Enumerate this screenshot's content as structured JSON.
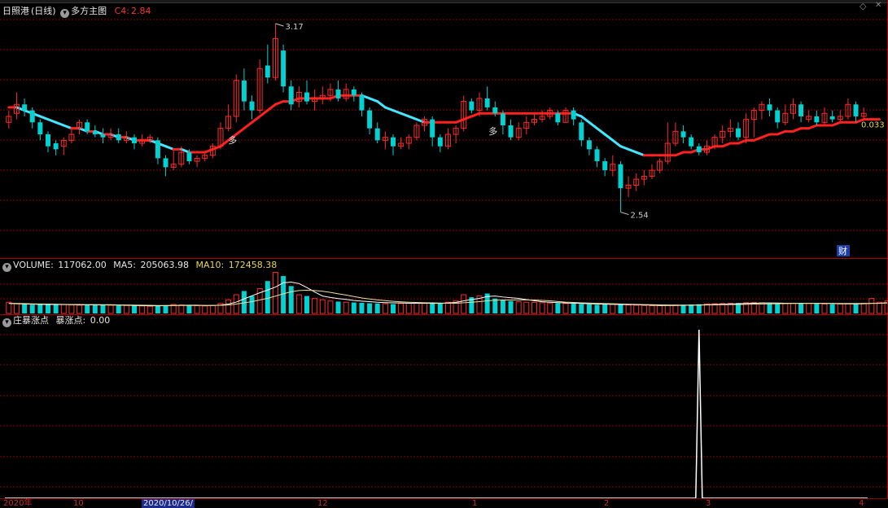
{
  "header": {
    "stock_name": "日照港",
    "period": "(日线)",
    "indicator_name": "多方主图",
    "c4_label": "C4:",
    "c4_value": "2.84"
  },
  "volume_header": {
    "label": "VOLUME:",
    "value": "117062.00",
    "ma5_label": "MA5:",
    "ma5_value": "205063.98",
    "ma10_label": "MA10:",
    "ma10_value": "172458.38"
  },
  "indicator_header": {
    "name": "庄暴涨点",
    "label": "暴涨点:",
    "value": "0.00"
  },
  "annotations": {
    "high": "3.17",
    "low": "2.54",
    "right_value": "0.033",
    "signal_a": "多",
    "signal_b": "多",
    "finance_badge": "财"
  },
  "date_axis": {
    "left_year": "2020年",
    "selected_date": "2020/10/26/",
    "months": [
      "10",
      "12",
      "1",
      "2",
      "3",
      "4"
    ]
  },
  "colors": {
    "up": "#ff2a2a",
    "down": "#00d2d2",
    "ma_up": "#ff2020",
    "ma_down": "#44e6ff",
    "grid": "#8b0000",
    "ma10": "#e8e0a0",
    "spike": "#ffffff"
  },
  "chart_data": {
    "type": "candlestick",
    "title": "",
    "price_range": [
      2.4,
      3.2
    ],
    "highest": 3.17,
    "lowest": 2.54,
    "candles": [
      {
        "o": 2.84,
        "c": 2.86,
        "h": 2.88,
        "l": 2.82
      },
      {
        "o": 2.87,
        "c": 2.9,
        "h": 2.94,
        "l": 2.85
      },
      {
        "o": 2.9,
        "c": 2.88,
        "h": 2.92,
        "l": 2.86
      },
      {
        "o": 2.88,
        "c": 2.84,
        "h": 2.89,
        "l": 2.82
      },
      {
        "o": 2.84,
        "c": 2.8,
        "h": 2.85,
        "l": 2.78
      },
      {
        "o": 2.8,
        "c": 2.76,
        "h": 2.81,
        "l": 2.74
      },
      {
        "o": 2.77,
        "c": 2.75,
        "h": 2.78,
        "l": 2.73
      },
      {
        "o": 2.76,
        "c": 2.78,
        "h": 2.79,
        "l": 2.73
      },
      {
        "o": 2.78,
        "c": 2.8,
        "h": 2.82,
        "l": 2.77
      },
      {
        "o": 2.82,
        "c": 2.84,
        "h": 2.85,
        "l": 2.8
      },
      {
        "o": 2.84,
        "c": 2.81,
        "h": 2.85,
        "l": 2.8
      },
      {
        "o": 2.81,
        "c": 2.8,
        "h": 2.83,
        "l": 2.79
      },
      {
        "o": 2.8,
        "c": 2.79,
        "h": 2.82,
        "l": 2.77
      },
      {
        "o": 2.79,
        "c": 2.8,
        "h": 2.82,
        "l": 2.78
      },
      {
        "o": 2.8,
        "c": 2.78,
        "h": 2.82,
        "l": 2.77
      },
      {
        "o": 2.78,
        "c": 2.79,
        "h": 2.81,
        "l": 2.77
      },
      {
        "o": 2.79,
        "c": 2.77,
        "h": 2.8,
        "l": 2.75
      },
      {
        "o": 2.77,
        "c": 2.78,
        "h": 2.8,
        "l": 2.76
      },
      {
        "o": 2.78,
        "c": 2.79,
        "h": 2.8,
        "l": 2.77
      },
      {
        "o": 2.78,
        "c": 2.72,
        "h": 2.79,
        "l": 2.7
      },
      {
        "o": 2.72,
        "c": 2.69,
        "h": 2.73,
        "l": 2.66
      },
      {
        "o": 2.69,
        "c": 2.7,
        "h": 2.75,
        "l": 2.68
      },
      {
        "o": 2.7,
        "c": 2.74,
        "h": 2.76,
        "l": 2.69
      },
      {
        "o": 2.74,
        "c": 2.71,
        "h": 2.75,
        "l": 2.7
      },
      {
        "o": 2.71,
        "c": 2.72,
        "h": 2.73,
        "l": 2.69
      },
      {
        "o": 2.72,
        "c": 2.73,
        "h": 2.74,
        "l": 2.71
      },
      {
        "o": 2.73,
        "c": 2.76,
        "h": 2.77,
        "l": 2.72
      },
      {
        "o": 2.76,
        "c": 2.82,
        "h": 2.84,
        "l": 2.75
      },
      {
        "o": 2.82,
        "c": 2.86,
        "h": 2.9,
        "l": 2.81
      },
      {
        "o": 2.86,
        "c": 2.98,
        "h": 3.0,
        "l": 2.84
      },
      {
        "o": 2.98,
        "c": 2.91,
        "h": 3.02,
        "l": 2.88
      },
      {
        "o": 2.91,
        "c": 2.88,
        "h": 2.93,
        "l": 2.85
      },
      {
        "o": 2.88,
        "c": 3.02,
        "h": 3.05,
        "l": 2.87
      },
      {
        "o": 3.03,
        "c": 2.99,
        "h": 3.1,
        "l": 2.97
      },
      {
        "o": 2.99,
        "c": 3.12,
        "h": 3.17,
        "l": 2.98
      },
      {
        "o": 3.08,
        "c": 2.96,
        "h": 3.1,
        "l": 2.94
      },
      {
        "o": 2.96,
        "c": 2.9,
        "h": 2.98,
        "l": 2.88
      },
      {
        "o": 2.91,
        "c": 2.94,
        "h": 2.96,
        "l": 2.89
      },
      {
        "o": 2.94,
        "c": 2.91,
        "h": 2.98,
        "l": 2.9
      },
      {
        "o": 2.91,
        "c": 2.92,
        "h": 2.95,
        "l": 2.88
      },
      {
        "o": 2.92,
        "c": 2.93,
        "h": 2.96,
        "l": 2.9
      },
      {
        "o": 2.93,
        "c": 2.95,
        "h": 2.97,
        "l": 2.91
      },
      {
        "o": 2.95,
        "c": 2.92,
        "h": 2.98,
        "l": 2.91
      },
      {
        "o": 2.92,
        "c": 2.95,
        "h": 2.97,
        "l": 2.91
      },
      {
        "o": 2.95,
        "c": 2.93,
        "h": 2.96,
        "l": 2.91
      },
      {
        "o": 2.93,
        "c": 2.88,
        "h": 2.94,
        "l": 2.86
      },
      {
        "o": 2.88,
        "c": 2.82,
        "h": 2.89,
        "l": 2.8
      },
      {
        "o": 2.82,
        "c": 2.78,
        "h": 2.84,
        "l": 2.77
      },
      {
        "o": 2.78,
        "c": 2.79,
        "h": 2.81,
        "l": 2.75
      },
      {
        "o": 2.79,
        "c": 2.76,
        "h": 2.8,
        "l": 2.73
      },
      {
        "o": 2.76,
        "c": 2.77,
        "h": 2.79,
        "l": 2.75
      },
      {
        "o": 2.77,
        "c": 2.79,
        "h": 2.8,
        "l": 2.75
      },
      {
        "o": 2.79,
        "c": 2.83,
        "h": 2.84,
        "l": 2.78
      },
      {
        "o": 2.83,
        "c": 2.85,
        "h": 2.86,
        "l": 2.81
      },
      {
        "o": 2.85,
        "c": 2.79,
        "h": 2.86,
        "l": 2.76
      },
      {
        "o": 2.79,
        "c": 2.76,
        "h": 2.8,
        "l": 2.74
      },
      {
        "o": 2.76,
        "c": 2.8,
        "h": 2.82,
        "l": 2.75
      },
      {
        "o": 2.8,
        "c": 2.82,
        "h": 2.83,
        "l": 2.77
      },
      {
        "o": 2.82,
        "c": 2.91,
        "h": 2.93,
        "l": 2.81
      },
      {
        "o": 2.91,
        "c": 2.88,
        "h": 2.92,
        "l": 2.87
      },
      {
        "o": 2.88,
        "c": 2.92,
        "h": 2.94,
        "l": 2.86
      },
      {
        "o": 2.92,
        "c": 2.89,
        "h": 2.96,
        "l": 2.88
      },
      {
        "o": 2.89,
        "c": 2.87,
        "h": 2.91,
        "l": 2.86
      },
      {
        "o": 2.87,
        "c": 2.83,
        "h": 2.88,
        "l": 2.8
      },
      {
        "o": 2.83,
        "c": 2.79,
        "h": 2.85,
        "l": 2.78
      },
      {
        "o": 2.79,
        "c": 2.82,
        "h": 2.84,
        "l": 2.78
      },
      {
        "o": 2.82,
        "c": 2.84,
        "h": 2.86,
        "l": 2.8
      },
      {
        "o": 2.84,
        "c": 2.85,
        "h": 2.87,
        "l": 2.83
      },
      {
        "o": 2.85,
        "c": 2.86,
        "h": 2.88,
        "l": 2.84
      },
      {
        "o": 2.86,
        "c": 2.88,
        "h": 2.89,
        "l": 2.85
      },
      {
        "o": 2.87,
        "c": 2.84,
        "h": 2.88,
        "l": 2.83
      },
      {
        "o": 2.84,
        "c": 2.88,
        "h": 2.89,
        "l": 2.84
      },
      {
        "o": 2.88,
        "c": 2.85,
        "h": 2.89,
        "l": 2.83
      },
      {
        "o": 2.84,
        "c": 2.78,
        "h": 2.85,
        "l": 2.76
      },
      {
        "o": 2.78,
        "c": 2.75,
        "h": 2.79,
        "l": 2.73
      },
      {
        "o": 2.75,
        "c": 2.71,
        "h": 2.76,
        "l": 2.69
      },
      {
        "o": 2.71,
        "c": 2.68,
        "h": 2.72,
        "l": 2.66
      },
      {
        "o": 2.68,
        "c": 2.7,
        "h": 2.73,
        "l": 2.66
      },
      {
        "o": 2.7,
        "c": 2.62,
        "h": 2.71,
        "l": 2.54
      },
      {
        "o": 2.62,
        "c": 2.63,
        "h": 2.66,
        "l": 2.59
      },
      {
        "o": 2.63,
        "c": 2.65,
        "h": 2.67,
        "l": 2.61
      },
      {
        "o": 2.65,
        "c": 2.66,
        "h": 2.68,
        "l": 2.63
      },
      {
        "o": 2.66,
        "c": 2.68,
        "h": 2.7,
        "l": 2.65
      },
      {
        "o": 2.68,
        "c": 2.71,
        "h": 2.72,
        "l": 2.67
      },
      {
        "o": 2.71,
        "c": 2.77,
        "h": 2.84,
        "l": 2.7
      },
      {
        "o": 2.77,
        "c": 2.81,
        "h": 2.84,
        "l": 2.76
      },
      {
        "o": 2.81,
        "c": 2.79,
        "h": 2.83,
        "l": 2.77
      },
      {
        "o": 2.79,
        "c": 2.76,
        "h": 2.8,
        "l": 2.75
      },
      {
        "o": 2.76,
        "c": 2.74,
        "h": 2.77,
        "l": 2.73
      },
      {
        "o": 2.74,
        "c": 2.76,
        "h": 2.78,
        "l": 2.73
      },
      {
        "o": 2.76,
        "c": 2.79,
        "h": 2.8,
        "l": 2.75
      },
      {
        "o": 2.79,
        "c": 2.81,
        "h": 2.83,
        "l": 2.77
      },
      {
        "o": 2.81,
        "c": 2.82,
        "h": 2.85,
        "l": 2.79
      },
      {
        "o": 2.82,
        "c": 2.79,
        "h": 2.84,
        "l": 2.78
      },
      {
        "o": 2.79,
        "c": 2.85,
        "h": 2.87,
        "l": 2.77
      },
      {
        "o": 2.85,
        "c": 2.88,
        "h": 2.89,
        "l": 2.79
      },
      {
        "o": 2.88,
        "c": 2.9,
        "h": 2.91,
        "l": 2.85
      },
      {
        "o": 2.9,
        "c": 2.88,
        "h": 2.92,
        "l": 2.86
      },
      {
        "o": 2.88,
        "c": 2.84,
        "h": 2.89,
        "l": 2.82
      },
      {
        "o": 2.84,
        "c": 2.87,
        "h": 2.9,
        "l": 2.83
      },
      {
        "o": 2.87,
        "c": 2.9,
        "h": 2.92,
        "l": 2.85
      },
      {
        "o": 2.9,
        "c": 2.86,
        "h": 2.91,
        "l": 2.84
      },
      {
        "o": 2.85,
        "c": 2.86,
        "h": 2.88,
        "l": 2.84
      },
      {
        "o": 2.86,
        "c": 2.84,
        "h": 2.88,
        "l": 2.83
      },
      {
        "o": 2.84,
        "c": 2.87,
        "h": 2.89,
        "l": 2.83
      },
      {
        "o": 2.86,
        "c": 2.85,
        "h": 2.88,
        "l": 2.84
      },
      {
        "o": 2.85,
        "c": 2.86,
        "h": 2.88,
        "l": 2.84
      },
      {
        "o": 2.86,
        "c": 2.9,
        "h": 2.92,
        "l": 2.85
      },
      {
        "o": 2.9,
        "c": 2.86,
        "h": 2.91,
        "l": 2.84
      },
      {
        "o": 2.86,
        "c": 2.87,
        "h": 2.89,
        "l": 2.85
      }
    ],
    "ma_line": {
      "values": [
        2.89,
        2.89,
        2.88,
        2.87,
        2.86,
        2.85,
        2.84,
        2.83,
        2.82,
        2.82,
        2.81,
        2.81,
        2.8,
        2.8,
        2.79,
        2.79,
        2.78,
        2.78,
        2.78,
        2.77,
        2.76,
        2.75,
        2.75,
        2.74,
        2.74,
        2.74,
        2.75,
        2.76,
        2.78,
        2.8,
        2.82,
        2.84,
        2.86,
        2.88,
        2.9,
        2.91,
        2.91,
        2.92,
        2.92,
        2.92,
        2.92,
        2.92,
        2.93,
        2.93,
        2.93,
        2.93,
        2.92,
        2.91,
        2.89,
        2.88,
        2.87,
        2.86,
        2.85,
        2.84,
        2.84,
        2.84,
        2.84,
        2.84,
        2.85,
        2.86,
        2.87,
        2.87,
        2.87,
        2.87,
        2.87,
        2.87,
        2.87,
        2.87,
        2.87,
        2.87,
        2.87,
        2.87,
        2.87,
        2.86,
        2.84,
        2.82,
        2.8,
        2.78,
        2.76,
        2.75,
        2.74,
        2.73,
        2.73,
        2.73,
        2.73,
        2.73,
        2.74,
        2.74,
        2.75,
        2.75,
        2.76,
        2.76,
        2.77,
        2.77,
        2.78,
        2.78,
        2.79,
        2.8,
        2.8,
        2.81,
        2.81,
        2.82,
        2.82,
        2.83,
        2.83,
        2.83,
        2.84,
        2.84,
        2.84,
        2.85,
        2.85,
        2.85
      ],
      "up_color_sections": "red when rising, cyan when falling"
    },
    "volume": {
      "values": [
        90,
        80,
        75,
        70,
        72,
        74,
        70,
        72,
        68,
        66,
        70,
        72,
        68,
        66,
        62,
        64,
        62,
        60,
        58,
        60,
        66,
        72,
        68,
        64,
        62,
        60,
        65,
        80,
        110,
        150,
        180,
        140,
        200,
        260,
        330,
        300,
        220,
        150,
        140,
        120,
        110,
        100,
        95,
        90,
        88,
        85,
        82,
        80,
        78,
        75,
        80,
        82,
        85,
        80,
        82,
        85,
        90,
        100,
        150,
        130,
        140,
        160,
        120,
        110,
        100,
        95,
        90,
        88,
        86,
        84,
        82,
        80,
        78,
        76,
        74,
        70,
        72,
        75,
        70,
        68,
        66,
        64,
        62,
        64,
        66,
        68,
        70,
        72,
        74,
        76,
        78,
        80,
        82,
        84,
        86,
        88,
        85,
        80,
        78,
        80,
        82,
        84,
        80,
        78,
        76,
        74,
        76,
        78,
        80,
        82,
        120,
        90,
        100
      ],
      "ma5": [
        80,
        78,
        76,
        74,
        73,
        72,
        72,
        71,
        70,
        69,
        69,
        69,
        68,
        68,
        66,
        65,
        64,
        62,
        61,
        61,
        62,
        64,
        65,
        66,
        66,
        64,
        64,
        67,
        75,
        91,
        117,
        142,
        166,
        188,
        212,
        246,
        252,
        240,
        208,
        172,
        140,
        128,
        119,
        113,
        104,
        99,
        95,
        90,
        87,
        85,
        84,
        82,
        82,
        82,
        81,
        81,
        84,
        88,
        101,
        111,
        121,
        136,
        140,
        132,
        126,
        121,
        111,
        102,
        94,
        90,
        87,
        84,
        82,
        80,
        78,
        76,
        74,
        73,
        72,
        71,
        70,
        68,
        66,
        64,
        64,
        64,
        65,
        66,
        68,
        70,
        72,
        74,
        76,
        78,
        80,
        82,
        84,
        84,
        83,
        82,
        81,
        81,
        81,
        81,
        80,
        79,
        78,
        77,
        77,
        78,
        81,
        82,
        86
      ],
      "ma10": [
        82,
        80,
        79,
        77,
        76,
        75,
        74,
        73,
        72,
        72,
        71,
        71,
        70,
        70,
        69,
        68,
        67,
        66,
        65,
        64,
        64,
        64,
        64,
        64,
        64,
        64,
        64,
        65,
        68,
        75,
        85,
        95,
        108,
        122,
        139,
        158,
        174,
        184,
        186,
        184,
        178,
        169,
        158,
        148,
        136,
        124,
        116,
        109,
        103,
        97,
        93,
        90,
        88,
        86,
        85,
        83,
        82,
        82,
        86,
        90,
        95,
        101,
        106,
        108,
        108,
        109,
        109,
        108,
        105,
        101,
        96,
        91,
        88,
        85,
        83,
        81,
        79,
        78,
        76,
        74,
        73,
        71,
        70,
        69,
        68,
        67,
        67,
        67,
        67,
        68,
        69,
        70,
        71,
        72,
        73,
        75,
        76,
        77,
        78,
        79,
        80,
        81,
        81,
        81,
        81,
        81,
        80,
        80,
        80,
        80,
        81,
        81,
        83
      ]
    },
    "indicator": {
      "name": "暴涨点",
      "values_nonzero": [
        {
          "index": 88,
          "value": 1
        }
      ],
      "current": 0.0
    }
  }
}
